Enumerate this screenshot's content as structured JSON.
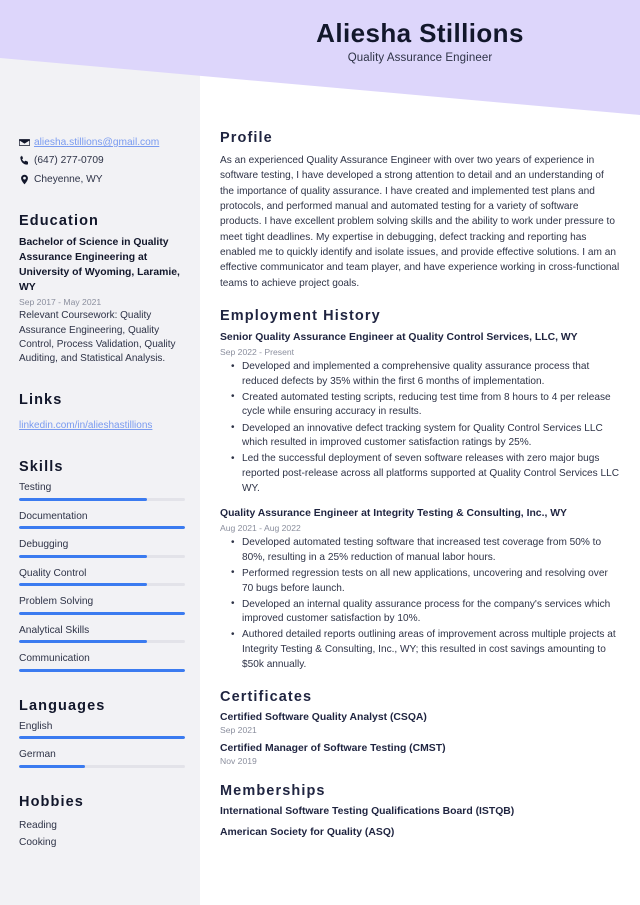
{
  "header": {
    "name": "Aliesha Stillions",
    "job_title": "Quality Assurance Engineer",
    "accent_color": "#ddd6fb"
  },
  "sidebar": {
    "background_color": "#f2f2f5",
    "contact": [
      {
        "icon": "envelope-icon",
        "text": "aliesha.stillions@gmail.com",
        "is_link": true
      },
      {
        "icon": "phone-icon",
        "text": "(647) 277-0709",
        "is_link": false
      },
      {
        "icon": "map-pin-icon",
        "text": "Cheyenne, WY",
        "is_link": false
      }
    ],
    "education": {
      "heading": "Education",
      "degree": "Bachelor of Science in Quality Assurance Engineering at University of Wyoming, Laramie, WY",
      "date": "Sep 2017 - May 2021",
      "details": "Relevant Coursework: Quality Assurance Engineering, Quality Control, Process Validation, Quality Auditing, and Statistical Analysis."
    },
    "links": {
      "heading": "Links",
      "items": [
        {
          "label": "linkedin.com/in/alieshastillions"
        }
      ]
    },
    "skills": {
      "heading": "Skills",
      "bar_color": "#3b7bf0",
      "track_color": "#e3e3e9",
      "items": [
        {
          "label": "Testing",
          "level": 77
        },
        {
          "label": "Documentation",
          "level": 100
        },
        {
          "label": "Debugging",
          "level": 77
        },
        {
          "label": "Quality Control",
          "level": 77
        },
        {
          "label": "Problem Solving",
          "level": 100
        },
        {
          "label": "Analytical Skills",
          "level": 77
        },
        {
          "label": "Communication",
          "level": 100
        }
      ]
    },
    "languages": {
      "heading": "Languages",
      "items": [
        {
          "label": "English",
          "level": 100
        },
        {
          "label": "German",
          "level": 40
        }
      ]
    },
    "hobbies": {
      "heading": "Hobbies",
      "items": [
        {
          "label": "Reading"
        },
        {
          "label": "Cooking"
        }
      ]
    }
  },
  "main": {
    "profile": {
      "heading": "Profile",
      "text": "As an experienced Quality Assurance Engineer with over two years of experience in software testing, I have developed a strong attention to detail and an understanding of the importance of quality assurance. I have created and implemented test plans and protocols, and performed manual and automated testing for a variety of software products. I have excellent problem solving skills and the ability to work under pressure to meet tight deadlines. My expertise in debugging, defect tracking and reporting has enabled me to quickly identify and isolate issues, and provide effective solutions. I am an effective communicator and team player, and have experience working in cross-functional teams to achieve project goals."
    },
    "employment": {
      "heading": "Employment History",
      "jobs": [
        {
          "title": "Senior Quality Assurance Engineer at Quality Control Services, LLC, WY",
          "date": "Sep 2022 - Present",
          "bullets": [
            "Developed and implemented a comprehensive quality assurance process that reduced defects by 35% within the first 6 months of implementation.",
            "Created automated testing scripts, reducing test time from 8 hours to 4 per release cycle while ensuring accuracy in results.",
            "Developed an innovative defect tracking system for Quality Control Services LLC which resulted in improved customer satisfaction ratings by 25%.",
            "Led the successful deployment of seven software releases with zero major bugs reported post-release across all platforms supported at Quality Control Services LLC WY."
          ]
        },
        {
          "title": "Quality Assurance Engineer at Integrity Testing & Consulting, Inc., WY",
          "date": "Aug 2021 - Aug 2022",
          "bullets": [
            "Developed automated testing software that increased test coverage from 50% to 80%, resulting in a 25% reduction of manual labor hours.",
            "Performed regression tests on all new applications, uncovering and resolving over 70 bugs before launch.",
            "Developed an internal quality assurance process for the company's services which improved customer satisfaction by 10%.",
            "Authored detailed reports outlining areas of improvement across multiple projects at Integrity Testing & Consulting, Inc., WY; this resulted in cost savings amounting to $50k annually."
          ]
        }
      ]
    },
    "certificates": {
      "heading": "Certificates",
      "items": [
        {
          "name": "Certified Software Quality Analyst (CSQA)",
          "date": "Sep 2021"
        },
        {
          "name": "Certified Manager of Software Testing (CMST)",
          "date": "Nov 2019"
        }
      ]
    },
    "memberships": {
      "heading": "Memberships",
      "items": [
        {
          "name": "International Software Testing Qualifications Board (ISTQB)"
        },
        {
          "name": "American Society for Quality (ASQ)"
        }
      ]
    }
  }
}
